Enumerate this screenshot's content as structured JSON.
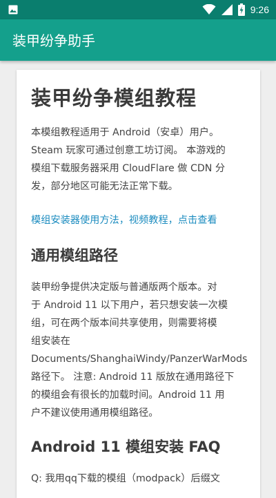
{
  "statusbar": {
    "time": "9:26",
    "icons": [
      "image-icon",
      "wifi-icon",
      "signal-icon",
      "battery-icon"
    ]
  },
  "appbar": {
    "title": "装甲纷争助手"
  },
  "article": {
    "title": "装甲纷争模组教程",
    "intro_lines": [
      "本模组教程适用于 Android（安卓）用户。",
      "Steam 玩家可通过创意工坊订阅。 本游戏的",
      "模组下载服务器采用 CloudFlare 做 CDN 分",
      "发，部分地区可能无法正常下载。"
    ],
    "link_text": "模组安装器使用方法，视频教程，点击查看",
    "section1_title": "通用模组路径",
    "section1_lines": [
      "装甲纷争提供决定版与普通版两个版本。对",
      "于 Android 11 以下用户，若只想安装一次模",
      "组，可在两个版本间共享使用，则需要将模",
      "组安装在",
      "Documents/ShanghaiWindy/PanzerWarMods",
      "路径下。 注意: Android 11 版放在通用路径下",
      "的模组会有很长的加载时间。Android 11 用",
      "户不建议使用通用模组路径。"
    ],
    "section2_title": "Android 11 模组安装 FAQ",
    "faq_line": "Q: 我用qq下载的模组（modpack）后缀文"
  },
  "colors": {
    "statusbar": "#0a7e6e",
    "appbar": "#14a08c",
    "link": "#1a8bbf",
    "background": "#eeeeee"
  }
}
